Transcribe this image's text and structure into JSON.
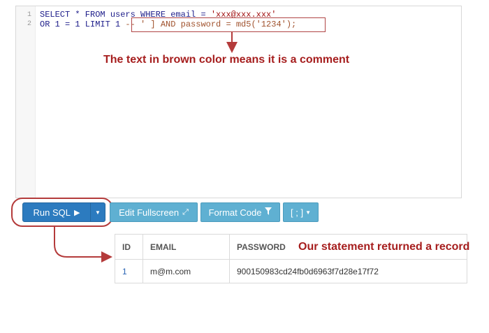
{
  "editor": {
    "lines": [
      {
        "num": "1",
        "code": "SELECT * FROM users WHERE email = ",
        "string": "'xxx@xxx.xxx'"
      },
      {
        "num": "2",
        "code": "OR 1 = 1 LIMIT 1 ",
        "comment": "-- ' ] AND password = md5('1234');"
      }
    ]
  },
  "annotations": {
    "comment_note": "The text in brown color means it is a comment",
    "result_note": "Our statement returned a record"
  },
  "toolbar": {
    "run_label": "Run SQL",
    "run_icon": "play-icon",
    "edit_fullscreen_label": "Edit Fullscreen",
    "edit_icon": "expand-icon",
    "format_code_label": "Format Code",
    "format_icon": "filter-icon",
    "semicolon_label": "[ ; ]",
    "caret_icon": "caret-down-icon"
  },
  "results": {
    "columns": [
      "ID",
      "EMAIL",
      "PASSWORD"
    ],
    "rows": [
      [
        "1",
        "m@m.com",
        "900150983cd24fb0d6963f7d28e17f72"
      ]
    ]
  },
  "colors": {
    "annotation": "#a61e1e",
    "run_button": "#2c7bbf",
    "secondary_button": "#5fb0d2"
  }
}
